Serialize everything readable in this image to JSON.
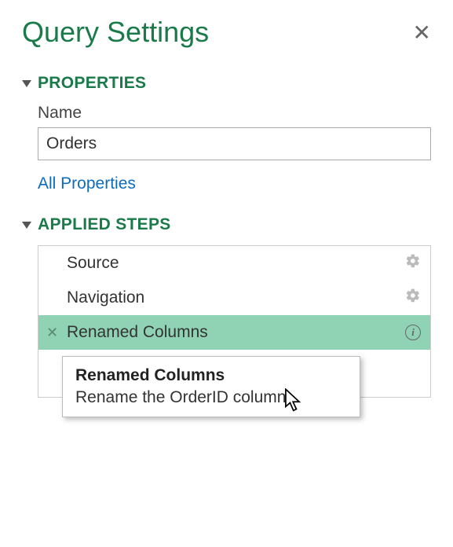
{
  "panel": {
    "title": "Query Settings"
  },
  "properties": {
    "heading": "PROPERTIES",
    "name_label": "Name",
    "name_value": "Orders",
    "all_props_link": "All Properties"
  },
  "steps": {
    "heading": "APPLIED STEPS",
    "items": [
      {
        "label": "Source",
        "has_gear": true,
        "selected": false
      },
      {
        "label": "Navigation",
        "has_gear": true,
        "selected": false
      },
      {
        "label": "Renamed Columns",
        "has_info": true,
        "selected": true
      }
    ]
  },
  "tooltip": {
    "title": "Renamed Columns",
    "description": "Rename the OrderID column."
  }
}
